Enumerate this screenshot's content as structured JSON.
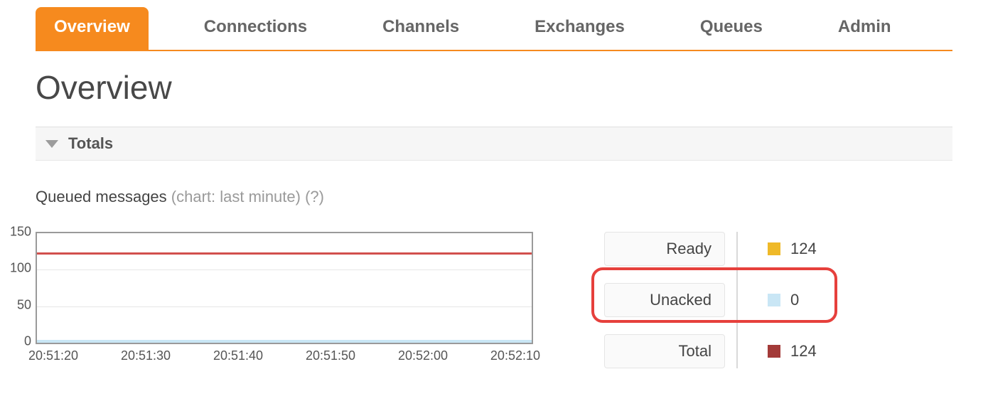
{
  "tabs": [
    {
      "label": "Overview",
      "active": true
    },
    {
      "label": "Connections",
      "active": false
    },
    {
      "label": "Channels",
      "active": false
    },
    {
      "label": "Exchanges",
      "active": false
    },
    {
      "label": "Queues",
      "active": false
    },
    {
      "label": "Admin",
      "active": false
    }
  ],
  "page_title": "Overview",
  "section": {
    "title": "Totals"
  },
  "chart": {
    "title": "Queued messages",
    "subtitle": "(chart: last minute)",
    "help": "(?)"
  },
  "legend": {
    "ready": {
      "label": "Ready",
      "value": "124",
      "color": "#efb928"
    },
    "unacked": {
      "label": "Unacked",
      "value": "0",
      "color": "#c9e6f5"
    },
    "total": {
      "label": "Total",
      "value": "124",
      "color": "#a33a38"
    }
  },
  "chart_data": {
    "type": "line",
    "x": [
      "20:51:20",
      "20:51:30",
      "20:51:40",
      "20:51:50",
      "20:52:00",
      "20:52:10"
    ],
    "series": [
      {
        "name": "Ready",
        "values": [
          124,
          124,
          124,
          124,
          124,
          124
        ],
        "color": "#d2504d"
      },
      {
        "name": "Unacked",
        "values": [
          0,
          0,
          0,
          0,
          0,
          0
        ],
        "color": "#c9e6f5"
      }
    ],
    "ylabel": "",
    "xlabel": "",
    "ylim": [
      0,
      150
    ],
    "yticks": [
      0,
      50,
      100,
      150
    ]
  }
}
